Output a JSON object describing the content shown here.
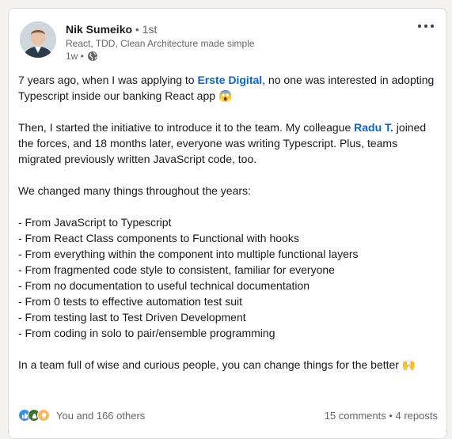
{
  "author": {
    "name": "Nik Sumeiko",
    "degree": "• 1st",
    "headline": "React, TDD, Clean Architecture made simple",
    "time": "1w •"
  },
  "post": {
    "p1_a": "7 years ago, when I was applying to ",
    "p1_mention": "Erste Digital",
    "p1_b": ", no one was interested in adopting Typescript inside our banking React app ",
    "p1_emoji": "😱",
    "p2_a": "Then, I started the initiative to introduce it to the team. My colleague ",
    "p2_mention": "Radu T.",
    "p2_b": " joined the forces, and 18 months later, everyone was writing Typescript. Plus, teams migrated previously written JavaScript code, too.",
    "p3": "We changed many things throughout the years:",
    "list": [
      "- From JavaScript to Typescript",
      "- From React Class components to Functional with hooks",
      "- From everything within the component into multiple functional layers",
      "- From fragmented code style to consistent, familiar for everyone",
      "- From no documentation to useful technical documentation",
      "- From 0 tests to effective automation test suit",
      "- From testing last to Test Driven Development",
      "- From coding in solo to pair/ensemble programming"
    ],
    "p4": "In a team full of wise and curious people, you can change things for the better ",
    "p4_emoji": "🙌"
  },
  "social": {
    "reactions_text": "You and 166 others",
    "comments": "15 comments",
    "separator": " • ",
    "reposts": "4 reposts"
  },
  "colors": {
    "link": "#0a66c2",
    "like": "#378fe9",
    "celebrate": "#44712e",
    "insightful": "#f5bb5c"
  }
}
